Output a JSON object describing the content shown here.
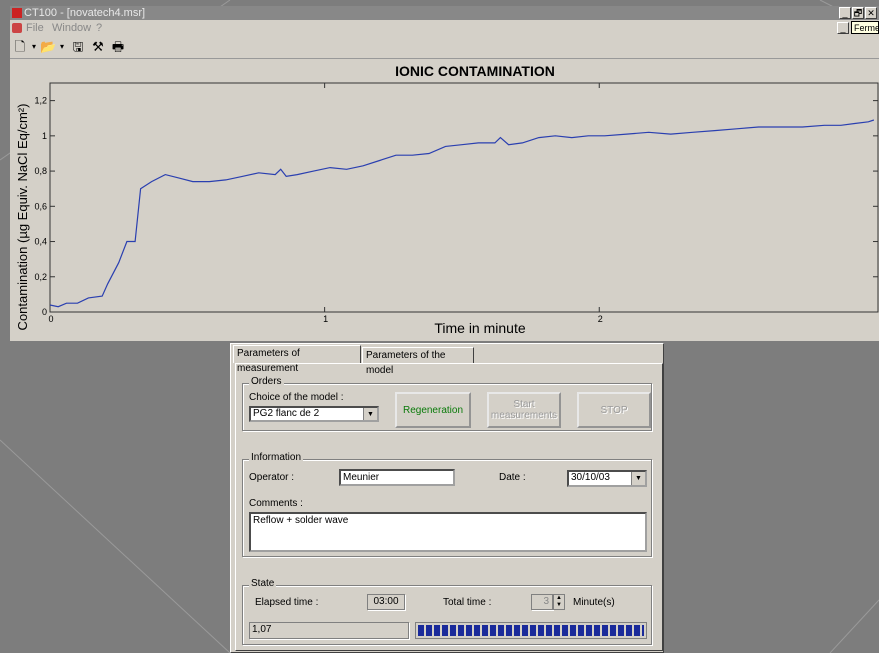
{
  "window": {
    "title": "CT100 - [novatech4.msr]",
    "min": "_",
    "max": "🗗",
    "close": "✕"
  },
  "menu": {
    "items": [
      "File",
      "Window",
      "?"
    ],
    "tooltip": "Fermer",
    "mdi_min": "_"
  },
  "toolbar": {
    "new": "🗋",
    "open": "📂",
    "save": "🖫",
    "tools": "⚒",
    "print": "🖶"
  },
  "chart_data": {
    "type": "line",
    "title": "IONIC CONTAMINATION",
    "xlabel": "Time in minute",
    "ylabel": "Contamination (µg Equiv. NaCl Eq/cm²)",
    "xlim": [
      0,
      3
    ],
    "ylim": [
      0,
      1.3
    ],
    "xticks": [
      "0",
      "1",
      "2"
    ],
    "yticks": [
      "0",
      "0,2",
      "0,4",
      "0,6",
      "0,8",
      "1",
      "1,2"
    ],
    "series": [
      {
        "color": "#2a3fb0",
        "x": [
          0,
          0.03,
          0.06,
          0.1,
          0.14,
          0.19,
          0.21,
          0.25,
          0.28,
          0.31,
          0.33,
          0.37,
          0.42,
          0.47,
          0.52,
          0.58,
          0.64,
          0.7,
          0.76,
          0.82,
          0.84,
          0.86,
          0.9,
          0.96,
          1.02,
          1.08,
          1.14,
          1.2,
          1.26,
          1.32,
          1.38,
          1.44,
          1.5,
          1.56,
          1.62,
          1.64,
          1.67,
          1.72,
          1.78,
          1.84,
          1.9,
          1.96,
          2.02,
          2.1,
          2.18,
          2.26,
          2.34,
          2.42,
          2.5,
          2.58,
          2.66,
          2.74,
          2.82,
          2.88,
          2.93,
          2.98,
          3.0
        ],
        "y": [
          0.04,
          0.03,
          0.05,
          0.05,
          0.08,
          0.09,
          0.16,
          0.28,
          0.4,
          0.4,
          0.7,
          0.74,
          0.78,
          0.76,
          0.74,
          0.74,
          0.75,
          0.77,
          0.79,
          0.78,
          0.81,
          0.77,
          0.78,
          0.8,
          0.82,
          0.81,
          0.83,
          0.86,
          0.89,
          0.89,
          0.9,
          0.94,
          0.95,
          0.96,
          0.96,
          0.99,
          0.95,
          0.96,
          0.99,
          1.0,
          0.99,
          1.0,
          1.0,
          1.01,
          1.02,
          1.01,
          1.02,
          1.03,
          1.04,
          1.05,
          1.05,
          1.05,
          1.06,
          1.06,
          1.07,
          1.08,
          1.09
        ]
      }
    ]
  },
  "tabs": [
    "Parameters of measurement",
    "Parameters of the model"
  ],
  "orders": {
    "legend": "Orders",
    "model_label": "Choice of the model :",
    "model_value": "PG2 flanc de 2",
    "regen_label": "Regeneration",
    "start_label": "Start\nmeasurements",
    "stop_label": "STOP"
  },
  "info": {
    "legend": "Information",
    "operator_label": "Operator :",
    "operator_value": "Meunier",
    "date_label": "Date :",
    "date_value": "30/10/03",
    "comments_label": "Comments :",
    "comments_value": "Reflow + solder wave"
  },
  "state": {
    "legend": "State",
    "elapsed_label": "Elapsed time :",
    "elapsed_value": "03:00",
    "total_label": "Total time :",
    "total_value": "3",
    "total_unit": "Minute(s)",
    "reading": "1,07",
    "progress": 1.0
  }
}
